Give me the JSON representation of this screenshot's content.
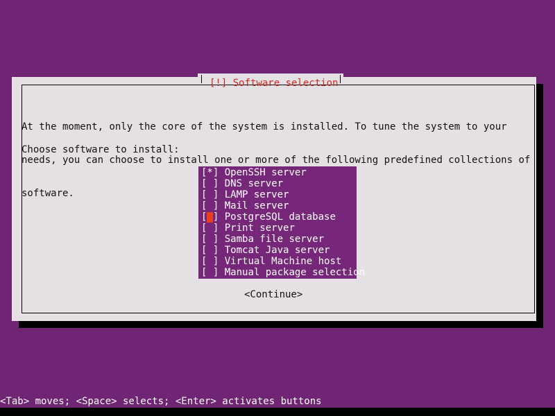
{
  "screen": {
    "background_color": "#6f2573",
    "text_color": "#ffffff"
  },
  "dialog": {
    "title": "[!] Software selection",
    "title_color": "#d02b20",
    "background_color": "#e4e0e4",
    "body_lines": [
      "At the moment, only the core of the system is installed. To tune the system to your",
      "needs, you can choose to install one or more of the following predefined collections of",
      "software."
    ],
    "prompt": "Choose software to install:",
    "continue_button": "<Continue>"
  },
  "listbox": {
    "background_color": "#76277a",
    "text_color": "#ffffff",
    "cursor_color": "#e8401a",
    "cursor_index": 4,
    "items": [
      {
        "marker": "[*]",
        "label": "OpenSSH server",
        "checked": true,
        "cursor": false
      },
      {
        "marker": "[ ]",
        "label": "DNS server",
        "checked": false,
        "cursor": false
      },
      {
        "marker": "[ ]",
        "label": "LAMP server",
        "checked": false,
        "cursor": false
      },
      {
        "marker": "[ ]",
        "label": "Mail server",
        "checked": false,
        "cursor": false
      },
      {
        "marker": "[ ]",
        "label": "PostgreSQL database",
        "checked": false,
        "cursor": true
      },
      {
        "marker": "[ ]",
        "label": "Print server",
        "checked": false,
        "cursor": false
      },
      {
        "marker": "[ ]",
        "label": "Samba file server",
        "checked": false,
        "cursor": false
      },
      {
        "marker": "[ ]",
        "label": "Tomcat Java server",
        "checked": false,
        "cursor": false
      },
      {
        "marker": "[ ]",
        "label": "Virtual Machine host",
        "checked": false,
        "cursor": false
      },
      {
        "marker": "[ ]",
        "label": "Manual package selection",
        "checked": false,
        "cursor": false
      }
    ]
  },
  "helpbar": {
    "text": "<Tab> moves; <Space> selects; <Enter> activates buttons"
  }
}
